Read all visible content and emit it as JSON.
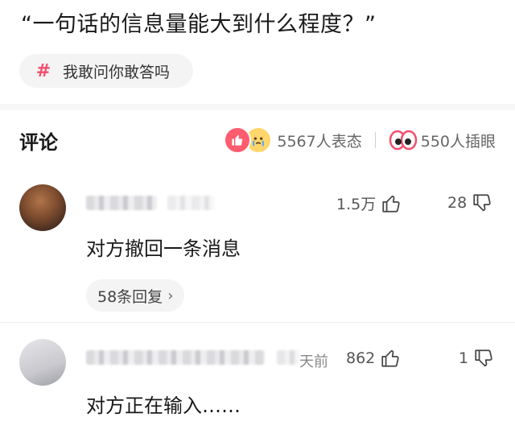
{
  "post": {
    "question": "“一句话的信息量能大到什么程度？”",
    "topic": {
      "icon": "hash-icon",
      "label": "我敢问你敢答吗"
    }
  },
  "comments_section": {
    "title": "评论",
    "reactions": {
      "icons": [
        "like-icon",
        "crying-face-icon"
      ],
      "text": "5567人表态"
    },
    "eye_pokes": {
      "icon": "eyes-icon",
      "text": "550人插眼"
    }
  },
  "comments": [
    {
      "avatar": "avatar-blurred",
      "time_fragment": "",
      "likes": "1.5万",
      "dislikes": "28",
      "text": "对方撤回一条消息",
      "replies": "58条回复"
    },
    {
      "avatar": "avatar-blurred",
      "time_fragment": "天前",
      "likes": "862",
      "dislikes": "1",
      "text": "对方正在输入……",
      "replies": ""
    }
  ],
  "colors": {
    "accent": "#f0506e",
    "chip_bg": "#f4f4f5",
    "text_primary": "#1a1a1a",
    "text_secondary": "#666666"
  }
}
